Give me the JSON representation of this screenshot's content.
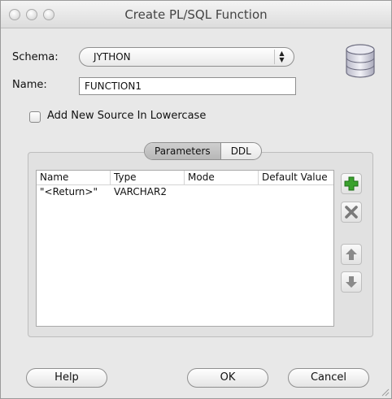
{
  "window": {
    "title": "Create PL/SQL Function"
  },
  "form": {
    "schema_label": "Schema:",
    "schema_value": "JYTHON",
    "name_label": "Name:",
    "name_value": "FUNCTION1",
    "lowercase_label": "Add New Source In Lowercase"
  },
  "tabs": [
    {
      "label": "Parameters",
      "active": true
    },
    {
      "label": "DDL",
      "active": false
    }
  ],
  "table": {
    "columns": [
      "Name",
      "Type",
      "Mode",
      "Default Value"
    ],
    "rows": [
      {
        "name": "\"<Return>\"",
        "type": "VARCHAR2",
        "mode": "",
        "default": ""
      }
    ]
  },
  "side_buttons": [
    {
      "icon": "add-icon",
      "color": "#3aa12d"
    },
    {
      "icon": "remove-icon",
      "color": "#7a7a7a"
    },
    {
      "icon": "arrow-up-icon",
      "color": "#8a8a8a"
    },
    {
      "icon": "arrow-down-icon",
      "color": "#8a8a8a"
    }
  ],
  "buttons": {
    "help": "Help",
    "ok": "OK",
    "cancel": "Cancel"
  }
}
